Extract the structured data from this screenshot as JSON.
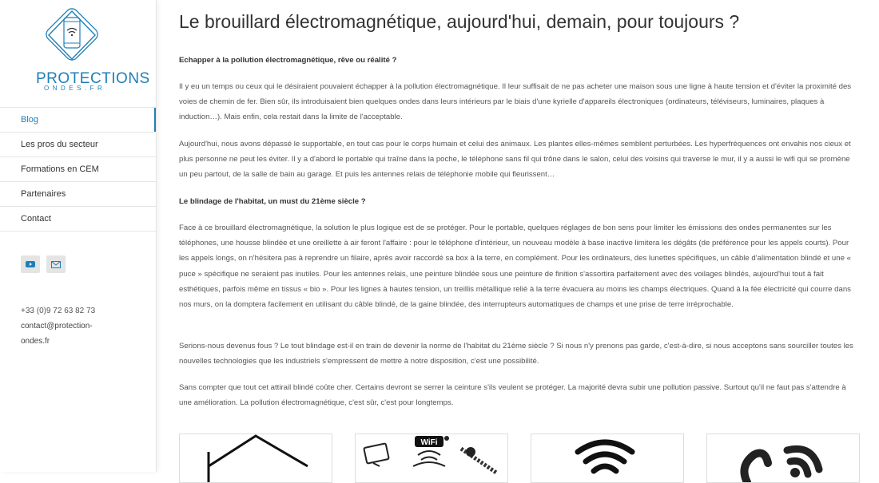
{
  "brand": {
    "name": "PROTECTIONS",
    "sub": "ONDES.FR"
  },
  "nav": [
    {
      "label": "Blog",
      "active": true
    },
    {
      "label": "Les pros du secteur",
      "active": false
    },
    {
      "label": "Formations en CEM",
      "active": false
    },
    {
      "label": "Partenaires",
      "active": false
    },
    {
      "label": "Contact",
      "active": false
    }
  ],
  "social": {
    "youtube": "youtube-icon",
    "email": "mail-icon"
  },
  "contact": {
    "phone": "+33 (0)9 72 63 82 73",
    "email_line1": "contact@protection-",
    "email_line2": "ondes.fr"
  },
  "article": {
    "title": "Le brouillard électromagnétique, aujourd'hui, demain, pour toujours ?",
    "subtitle1": "Echapper à la pollution électromagnétique, rêve ou réalité ?",
    "p1": "Il y eu un temps ou ceux qui le désiraient pouvaient échapper à la pollution électromagnétique. Il leur suffisait de ne pas acheter une maison sous une ligne à haute tension et d'éviter la proximité des voies de chemin de fer. Bien sûr, ils introduisaient bien quelques ondes dans leurs intérieurs par le biais d'une kyrielle d'appareils électroniques (ordinateurs, téléviseurs, luminaires, plaques à induction…). Mais enfin, cela restait dans la limite de l'acceptable.",
    "p2": "Aujourd'hui, nous avons dépassé le supportable, en tout cas pour le corps humain et celui des animaux. Les plantes elles-mêmes semblent perturbées. Les hyperfréquences ont envahis nos cieux et plus personne ne peut les éviter. Il y a d'abord le portable qui traîne dans la poche, le téléphone sans fil qui trône dans le salon, celui des voisins qui traverse le mur, il y a aussi le wifi qui se promène un peu partout, de la salle de bain au garage. Et puis les antennes relais de téléphonie mobile qui fleurissent…",
    "subtitle2": "Le blindage de l'habitat, un must du 21ème siècle ?",
    "p3": "Face à ce brouillard électromagnétique, la solution le plus logique est de se protéger. Pour le portable, quelques réglages de bon sens pour limiter les émissions des ondes permanentes sur les téléphones, une housse blindée et une oreillette à air feront l'affaire : pour le téléphone d'intérieur, un nouveau modèle à base inactive limitera les dégâts (de préférence pour les appels courts). Pour les appels longs, on n'hésitera pas à reprendre un filaire, après avoir raccordé sa box à la terre, en complément. Pour les ordinateurs, des lunettes spécifiques, un câble d'alimentation blindé et une « puce » spécifique ne seraient pas inutiles. Pour les antennes relais, une peinture blindée sous une peinture de finition s'assortira parfaitement avec des voilages blindés, aujourd'hui tout à fait esthétiques, parfois même en tissus « bio ». Pour les lignes à hautes tension, un treillis métallique relié à la terre évacuera au moins les champs électriques. Quand à la fée électricité qui courre dans nos murs, on la domptera facilement en utilisant du câble blindé, de la gaine blindée, des interrupteurs automatiques de champs et une prise de terre irréprochable.",
    "p4": "Serions-nous devenus fous ? Le tout blindage est-il en train de devenir la norme de l'habitat du 21ème siècle ? Si nous n'y prenons pas garde, c'est-à-dire, si nous acceptons sans sourciller toutes les nouvelles technologies que les industriels s'empressent de mettre à notre disposition, c'est une possibilité.",
    "p5": "Sans compter que tout cet attirail blindé coûte cher. Certains devront se serrer la ceinture s'ils veulent se protéger. La majorité devra subir une pollution passive. Surtout qu'il ne faut pas s'attendre à une amélioration. La pollution électromagnétique, c'est sûr, c'est pour longtemps."
  },
  "cards": [
    {
      "icon": "house-icon"
    },
    {
      "icon": "wifi-devices-icon",
      "badge": "WiFi"
    },
    {
      "icon": "wifi-icon"
    },
    {
      "icon": "signal-waves-icon"
    }
  ],
  "colors": {
    "accent": "#1e7fb6"
  }
}
